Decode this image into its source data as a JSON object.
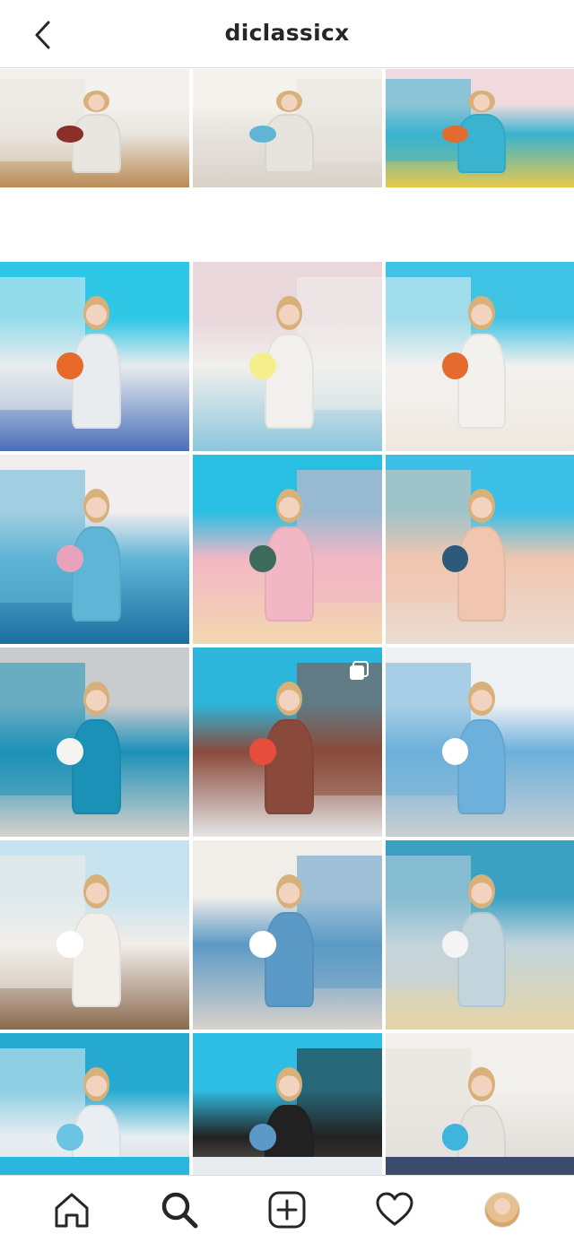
{
  "header": {
    "title": "diclassicx",
    "back_icon": "chevron-left-icon"
  },
  "grid": {
    "rows": [
      [
        {
          "top": "#f3f1ee",
          "mid": "#e9e5df",
          "bot": "#b98a55",
          "accent": "#8a2f2a"
        },
        {
          "top": "#f5f2ee",
          "mid": "#e7e3dd",
          "bot": "#d9d2c9",
          "accent": "#5fb5d5"
        },
        {
          "top": "#f0d9df",
          "mid": "#39b3cf",
          "bot": "#e8c84b",
          "accent": "#e36b2f"
        }
      ],
      [
        {
          "top": "#2ec7e6",
          "mid": "#e9ecef",
          "bot": "#4a6fb8",
          "accent": "#e76a2b"
        },
        {
          "top": "#e9d7dc",
          "mid": "#f1f0ec",
          "bot": "#8cc6dc",
          "accent": "#f4ee8c"
        },
        {
          "top": "#3fc3e4",
          "mid": "#f3f1ee",
          "bot": "#efe8df",
          "accent": "#e56a2d"
        }
      ],
      [
        {
          "top": "#f2eef0",
          "mid": "#5fb5d6",
          "bot": "#1b6fa1",
          "accent": "#e8a3bb"
        },
        {
          "top": "#29bfe2",
          "mid": "#f2b7c5",
          "bot": "#f3d8b0",
          "accent": "#3d6b5b"
        },
        {
          "top": "#3bbfe6",
          "mid": "#f1c6b0",
          "bot": "#e9dcd2",
          "accent": "#2d5a7a"
        }
      ],
      [
        {
          "top": "#c9ccce",
          "mid": "#1c91b8",
          "bot": "#d7d2cc",
          "accent": "#f4f4f1"
        },
        {
          "top": "#2eb5db",
          "mid": "#8a4a3b",
          "bot": "#e5e5e5",
          "accent": "#e74d3c"
        },
        {
          "top": "#eef1f3",
          "mid": "#6cb0db",
          "bot": "#c9cfd2",
          "accent": "#ffffff"
        }
      ],
      [
        {
          "top": "#c6e3ef",
          "mid": "#f2eeea",
          "bot": "#8b6a4f",
          "accent": "#ffffff"
        },
        {
          "top": "#f1eeea",
          "mid": "#5b9ac6",
          "bot": "#d8d2cb",
          "accent": "#ffffff"
        },
        {
          "top": "#3aa1c3",
          "mid": "#c2d4dc",
          "bot": "#e7d4a6",
          "accent": "#f4f4f4"
        }
      ],
      [
        {
          "top": "#25a9d0",
          "mid": "#e8eef2",
          "bot": "#bdc4c8",
          "accent": "#6cc4e2"
        },
        {
          "top": "#2ebde3",
          "mid": "#222222",
          "bot": "#b5a89c",
          "accent": "#5b9ac6"
        },
        {
          "top": "#f2f0ed",
          "mid": "#e6e2dd",
          "bot": "#d4cfc9",
          "accent": "#3fb5de"
        }
      ]
    ],
    "partial_row": [
      "#2bb6df",
      "#e6ecf0",
      "#3a4b6c"
    ]
  },
  "bottom_nav": {
    "items": [
      {
        "name": "home",
        "icon": "home-icon"
      },
      {
        "name": "search",
        "icon": "search-icon"
      },
      {
        "name": "new-post",
        "icon": "plus-square-icon"
      },
      {
        "name": "activity",
        "icon": "heart-icon"
      },
      {
        "name": "profile",
        "icon": "avatar"
      }
    ]
  }
}
